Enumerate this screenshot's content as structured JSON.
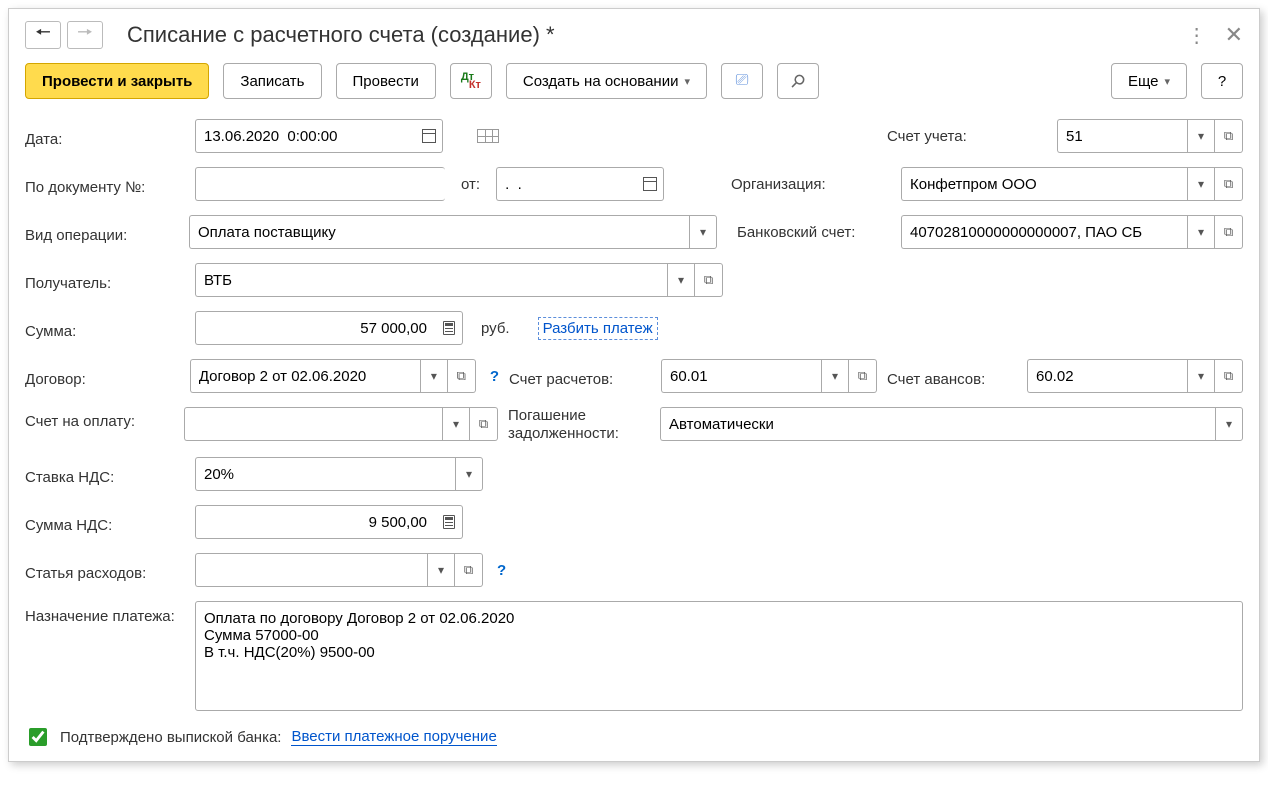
{
  "title": "Списание с расчетного счета (создание) *",
  "toolbar": {
    "post_and_close": "Провести и закрыть",
    "save": "Записать",
    "post": "Провести",
    "create_based": "Создать на основании",
    "more": "Еще",
    "help": "?"
  },
  "labels": {
    "date": "Дата:",
    "doc_no": "По документу №:",
    "from": "от:",
    "op_type": "Вид операции:",
    "recipient": "Получатель:",
    "sum": "Сумма:",
    "rub": "руб.",
    "split_payment": "Разбить платеж",
    "contract": "Договор:",
    "settlement_account": "Счет расчетов:",
    "advance_account": "Счет авансов:",
    "invoice": "Счет на оплату:",
    "debt_repayment": "Погашение задолженности:",
    "vat_rate": "Ставка НДС:",
    "vat_sum": "Сумма НДС:",
    "expense_item": "Статья расходов:",
    "purpose": "Назначение платежа:",
    "account": "Счет учета:",
    "organization": "Организация:",
    "bank_account": "Банковский счет:",
    "confirmed": "Подтверждено выпиской банка:",
    "enter_payment_order": "Ввести платежное поручение"
  },
  "values": {
    "date": "13.06.2020  0:00:00",
    "doc_no": "",
    "from_date": ".  .",
    "op_type": "Оплата поставщику",
    "recipient": "ВТБ",
    "sum": "57 000,00",
    "contract": "Договор 2 от 02.06.2020",
    "settlement_account": "60.01",
    "advance_account": "60.02",
    "invoice": "",
    "debt_repayment": "Автоматически",
    "vat_rate": "20%",
    "vat_sum": "9 500,00",
    "expense_item": "",
    "purpose": "Оплата по договору Договор 2 от 02.06.2020\nСумма 57000-00\nВ т.ч. НДС(20%) 9500-00",
    "account": "51",
    "organization": "Конфетпром ООО",
    "bank_account": "40702810000000000007, ПАО СБ",
    "confirmed": true
  }
}
